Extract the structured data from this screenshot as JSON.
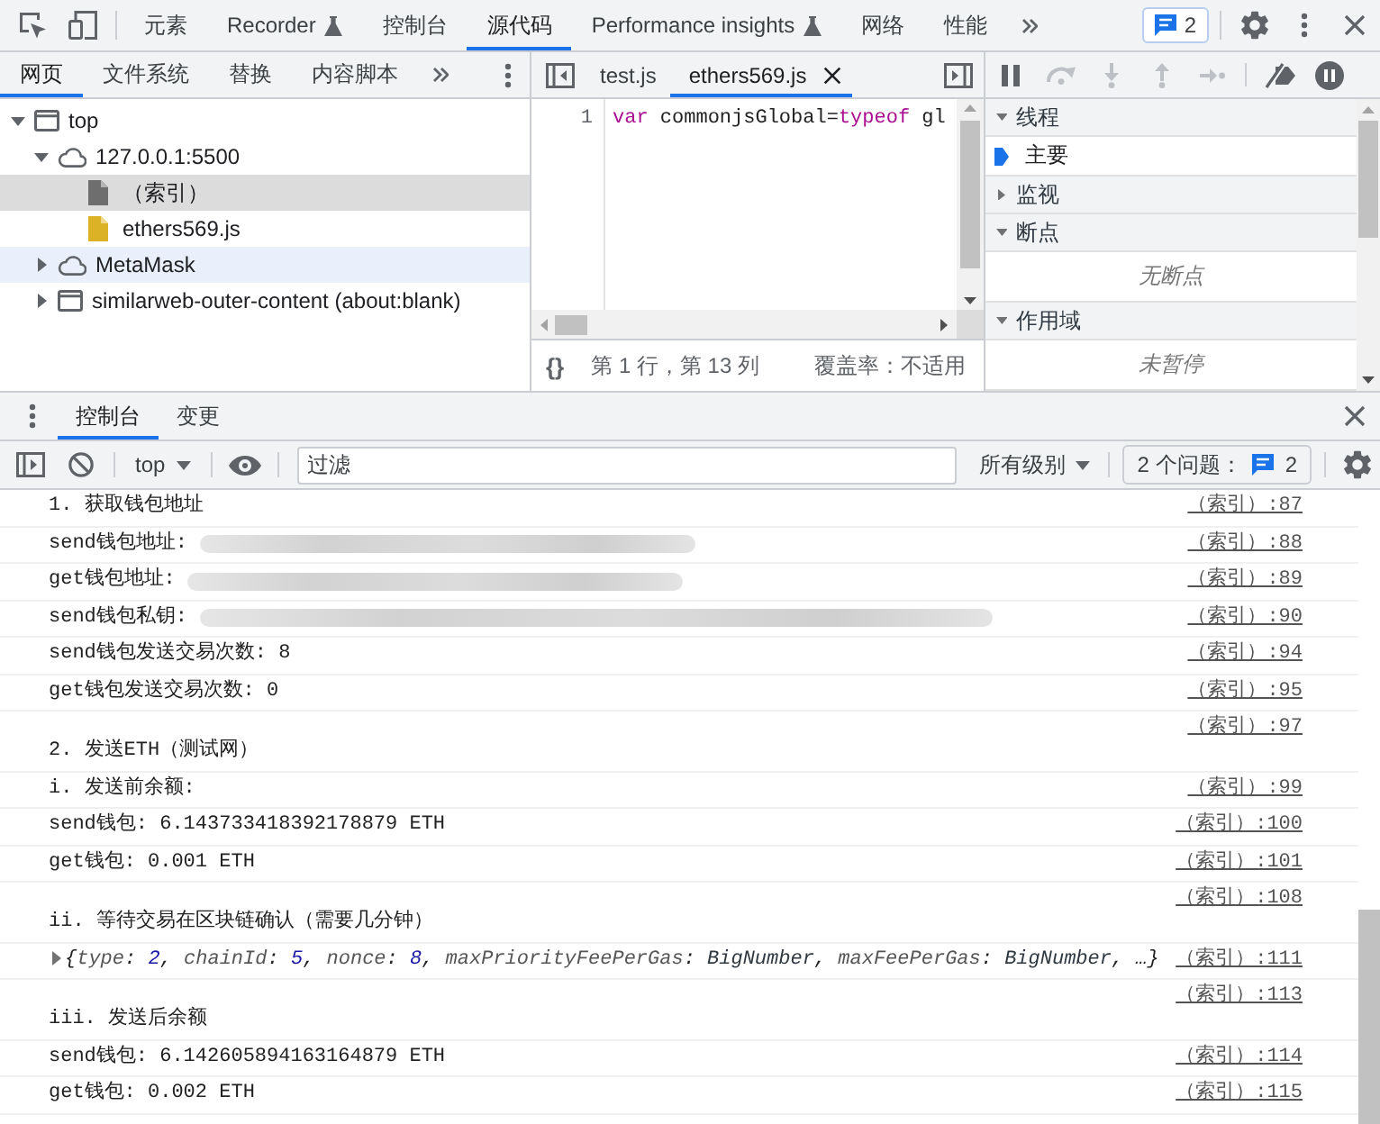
{
  "main_toolbar": {
    "tabs": [
      {
        "label": "元素",
        "selected": false,
        "experimental": false
      },
      {
        "label": "Recorder",
        "selected": false,
        "experimental": true
      },
      {
        "label": "控制台",
        "selected": false,
        "experimental": false
      },
      {
        "label": "源代码",
        "selected": true,
        "experimental": false
      },
      {
        "label": "Performance insights",
        "selected": false,
        "experimental": true
      },
      {
        "label": "网络",
        "selected": false,
        "experimental": false
      },
      {
        "label": "性能",
        "selected": false,
        "experimental": false
      }
    ],
    "issues_count": "2"
  },
  "navigator": {
    "tabs": [
      {
        "label": "网页",
        "selected": true
      },
      {
        "label": "文件系统",
        "selected": false
      },
      {
        "label": "替换",
        "selected": false
      },
      {
        "label": "内容脚本",
        "selected": false
      }
    ],
    "tree": [
      {
        "label": "top",
        "kind": "frame",
        "expanded": true,
        "selected": false,
        "highlighted": false,
        "children": [
          {
            "label": "127.0.0.1:5500",
            "kind": "origin",
            "expanded": true,
            "selected": false,
            "highlighted": false,
            "children": [
              {
                "label": "（索引）",
                "kind": "document",
                "selected": true,
                "highlighted": false
              },
              {
                "label": "ethers569.js",
                "kind": "script",
                "selected": false,
                "highlighted": false
              }
            ]
          },
          {
            "label": "MetaMask",
            "kind": "origin",
            "expanded": false,
            "selected": false,
            "highlighted": true
          },
          {
            "label": "similarweb-outer-content (about:blank)",
            "kind": "frame",
            "expanded": false,
            "selected": false,
            "highlighted": false
          }
        ]
      }
    ]
  },
  "editor": {
    "tabs": [
      {
        "label": "test.js",
        "selected": false
      },
      {
        "label": "ethers569.js",
        "selected": true
      }
    ],
    "lines": [
      {
        "number": "1",
        "tokens": [
          {
            "text": "var",
            "kind": "keyword"
          },
          {
            "text": " commonjsGlobal=",
            "kind": "plain"
          },
          {
            "text": "typeof",
            "kind": "keyword"
          },
          {
            "text": " gl",
            "kind": "plain"
          }
        ]
      }
    ],
    "format_button": "{}",
    "cursor_position": "第 1 行，第 13 列",
    "coverage": "覆盖率：不适用"
  },
  "debugger": {
    "paused": false,
    "sections": [
      {
        "title": "线程",
        "expanded": true,
        "threads": [
          {
            "label": "主要",
            "selected": true
          }
        ]
      },
      {
        "title": "监视",
        "expanded": false
      },
      {
        "title": "断点",
        "expanded": true,
        "empty_text": "无断点"
      },
      {
        "title": "作用域",
        "expanded": true,
        "empty_text": "未暂停"
      }
    ]
  },
  "drawer": {
    "tabs": [
      {
        "label": "控制台",
        "selected": true
      },
      {
        "label": "变更",
        "selected": false
      }
    ]
  },
  "console_toolbar": {
    "context": "top",
    "filter": {
      "placeholder": "过滤"
    },
    "log_levels": "所有级别",
    "issues": {
      "label": "2 个问题：",
      "count": "2"
    }
  },
  "console": {
    "messages": [
      {
        "kind": "text",
        "text": "1. 获取钱包地址",
        "source": "（索引）:87"
      },
      {
        "kind": "address",
        "text": "send钱包地址: ",
        "source": "（索引）:88"
      },
      {
        "kind": "address",
        "text": "get钱包地址: ",
        "source": "（索引）:89"
      },
      {
        "kind": "secret",
        "text": "send钱包私钥: ",
        "source": "（索引）:90"
      },
      {
        "kind": "text",
        "text": "send钱包发送交易次数: 8",
        "source": "（索引）:94"
      },
      {
        "kind": "text",
        "text": "get钱包发送交易次数: 0",
        "source": "（索引）:95"
      },
      {
        "kind": "text",
        "text": "\n2. 发送ETH（测试网）",
        "source": "（索引）:97"
      },
      {
        "kind": "text",
        "text": "i. 发送前余额:",
        "source": "（索引）:99"
      },
      {
        "kind": "text",
        "text": "send钱包: 6.143733418392178879 ETH",
        "source": "（索引）:100"
      },
      {
        "kind": "text",
        "text": "get钱包: 0.001 ETH",
        "source": "（索引）:101"
      },
      {
        "kind": "text",
        "text": "\nii. 等待交易在区块链确认（需要几分钟）",
        "source": "（索引）:108"
      },
      {
        "kind": "object",
        "expanded": false,
        "tokens": [
          {
            "text": "{",
            "kind": "punct"
          },
          {
            "text": "type",
            "kind": "key"
          },
          {
            "text": ": ",
            "kind": "punct"
          },
          {
            "text": "2",
            "kind": "number"
          },
          {
            "text": ", ",
            "kind": "punct"
          },
          {
            "text": "chainId",
            "kind": "key"
          },
          {
            "text": ": ",
            "kind": "punct"
          },
          {
            "text": "5",
            "kind": "number"
          },
          {
            "text": ", ",
            "kind": "punct"
          },
          {
            "text": "nonce",
            "kind": "key"
          },
          {
            "text": ": ",
            "kind": "punct"
          },
          {
            "text": "8",
            "kind": "number"
          },
          {
            "text": ", ",
            "kind": "punct"
          },
          {
            "text": "maxPriorityFeePerGas",
            "kind": "key"
          },
          {
            "text": ": ",
            "kind": "punct"
          },
          {
            "text": "BigNumber",
            "kind": "plain"
          },
          {
            "text": ", ",
            "kind": "punct"
          },
          {
            "text": "maxFeePerGas",
            "kind": "key"
          },
          {
            "text": ": ",
            "kind": "punct"
          },
          {
            "text": "BigNumber",
            "kind": "plain"
          },
          {
            "text": ", …}",
            "kind": "punct"
          }
        ],
        "source": "（索引）:111"
      },
      {
        "kind": "text",
        "text": "\niii. 发送后余额",
        "source": "（索引）:113"
      },
      {
        "kind": "text",
        "text": "send钱包: 6.142605894163164879 ETH",
        "source": "（索引）:114"
      },
      {
        "kind": "text",
        "text": "get钱包: 0.002 ETH",
        "source": "（索引）:115"
      }
    ]
  }
}
